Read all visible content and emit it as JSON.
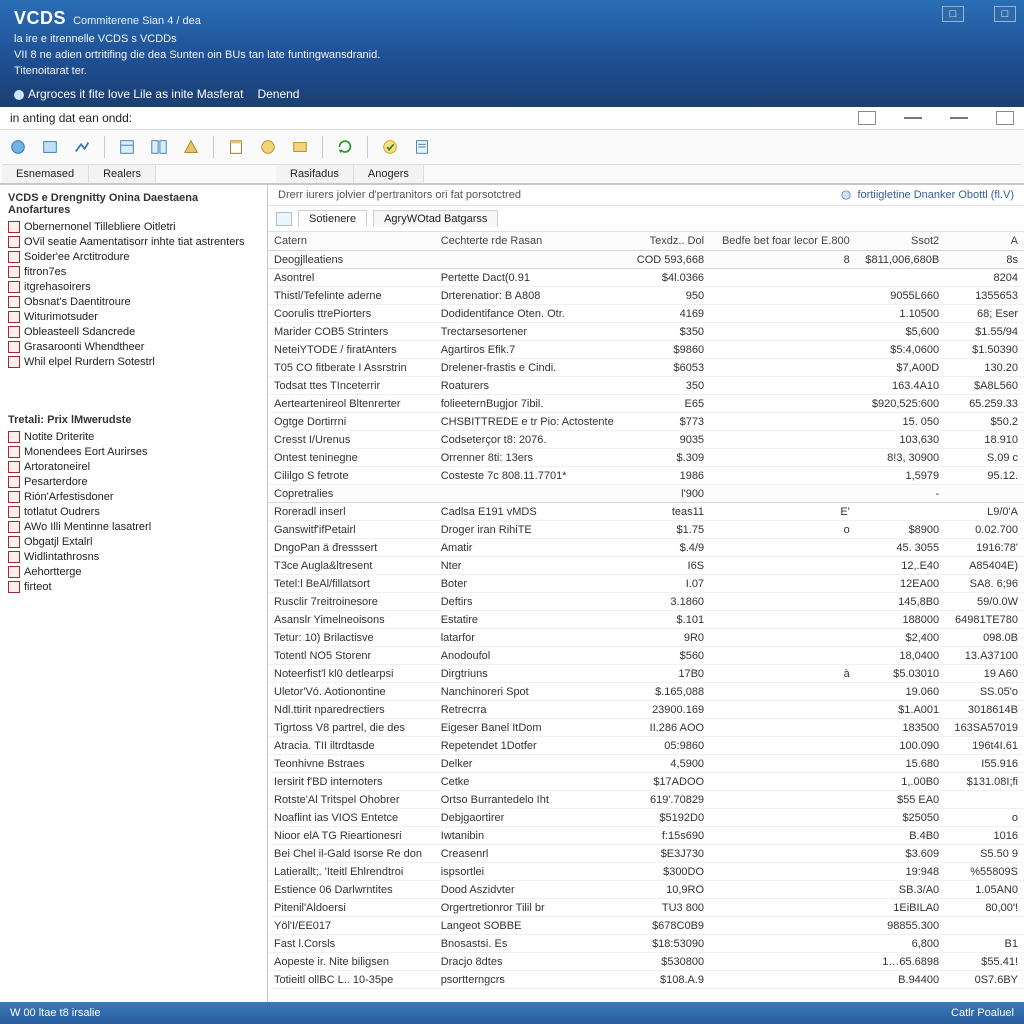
{
  "banner": {
    "title": "VCDS",
    "title_sub": "Commiterene Sian 4 / dea",
    "line_sub": "la ire e itrennelle VCDS s VCDDs",
    "line2": "VII 8 ne adien ortritifing die dea Sunten oin BUs tan late funtingwansdranid.",
    "line3": "Titenoitarat ter.",
    "link1": "Argroces it fite love Lile as inite Masferat",
    "link2": "Denend"
  },
  "windowbtns": {
    "a": "□",
    "b": "□"
  },
  "subheader": {
    "left": "in anting dat ean ondd:",
    "icons": [
      "□",
      "—",
      "—",
      "□"
    ]
  },
  "toolbar": {
    "tabs": [
      "Esnemased",
      "Realers",
      "Rasifadus",
      "Anogers"
    ]
  },
  "sidebar": {
    "group1_title": "VCDS e Drengnitty Onina Daestaena Anofartures",
    "group1": [
      "Obernernonel Tillebliere Oitletri",
      "OVil seatie Aamentatisorr inhte tiat astrenters",
      "Soider'ee Arctitrodure",
      "fitron7es",
      "itgrehasoirers",
      "Obsnat's Daentitroure",
      "Witurimotsuder",
      "Obleasteell Sdancrede",
      "Grasaroonti Whendtheer",
      "Whil elpel Rurdern Sotestrl"
    ],
    "group2_title": "Tretali: Prix lMwerudste",
    "group2": [
      "Notite Driterite",
      "Monendees Eort Aurirses",
      "Artoratoneirel",
      "Pesarterdore",
      "Rión'Arfestisdoner",
      "totlatut Oudrers",
      "AWo Illi Mentinne lasatrerl",
      "Obgatjl Extalrl",
      "Widlintathrosns",
      "Aehortterge",
      "firteot"
    ]
  },
  "content": {
    "header_left": "Drerr iurers jolvier d'pertranitors ori fat porsotctred",
    "header_right": "fortiigletine Dnanker Obottl (fl.V)",
    "subtabs": [
      "Sotienere",
      "AgryWOtad Batgarss"
    ]
  },
  "grid": {
    "columns": [
      "Catern",
      "Cechterte rde Rasan",
      "Texdz.. Dol",
      "Bedfe bet foar lecor E.800",
      "Ssot2",
      "A"
    ],
    "section1_label": "Deogjlleatiens",
    "section1_vals": [
      "COD 593,668",
      "8",
      "$811,006,680B",
      "8s"
    ],
    "rows1": [
      {
        "c0": "Asontrel",
        "c1": "Pertette Dact(0.91",
        "v0": "$4l.0366",
        "v1": "",
        "v2": "",
        "v3": "8204"
      },
      {
        "c0": "Thistl/Tefelinte aderne",
        "c1": "Drterenatior: B A808",
        "v0": "950",
        "v1": "",
        "v2": "9055L660",
        "v3": "1355653"
      },
      {
        "c0": "Coorulis ttrePiorters",
        "c1": "Dodidentifance Oten. Otr.",
        "v0": "4169",
        "v1": "",
        "v2": "1.10500",
        "v3": "68; Eser"
      },
      {
        "c0": "Marider COB5 Strinters",
        "c1": "Trectarsesortener",
        "v0": "$350",
        "v1": "",
        "v2": "$5,600",
        "v3": "$1.55/94"
      },
      {
        "c0": "NeteiYTODE / firatAnters",
        "c1": "Agartiros  Efik.7",
        "v0": "$9860",
        "v1": "",
        "v2": "$5:4,0600",
        "v3": "$1.50390"
      },
      {
        "c0": "T05 CO fitberate I Assrstrin",
        "c1": "Drelener-frastis e Cindi.",
        "v0": "$6053",
        "v1": "",
        "v2": "$7,A00D",
        "v3": "130.20"
      },
      {
        "c0": "Todsat ttes TInceterrir",
        "c1": "Roaturers",
        "v0": "350",
        "v1": "",
        "v2": "163.4A10",
        "v3": "$A8L560"
      },
      {
        "c0": "Aerteartenireol Bltenrerter",
        "c1": "folieeternBugjor  7ibil.",
        "v0": "E65",
        "v1": "",
        "v2": "$920,525:600",
        "v3": "65.259.33"
      },
      {
        "c0": "Ogtge Dortirrni",
        "c1": "CHSBITTREDE e tr Pio: Actostente",
        "v0": "$773",
        "v1": "",
        "v2": "15. 050",
        "v3": "$50.2"
      },
      {
        "c0": "Cresst I/Urenus",
        "c1": "Codseterçor t8: 2076.",
        "v0": "9035",
        "v1": "",
        "v2": "103,630",
        "v3": "18.910"
      },
      {
        "c0": "Ontest teninegne",
        "c1": "Orrenner 8ti: 13ers",
        "v0": "$.309",
        "v1": "",
        "v2": "8!3, 30900",
        "v3": "S.09 c"
      },
      {
        "c0": "Cililgo S fetrote",
        "c1": "Costeste 7c 808.11.7701*",
        "v0": "1986",
        "v1": "",
        "v2": "1,5979",
        "v3": "95.12."
      }
    ],
    "section2_label": "Copretralies",
    "section2_vals": [
      "l'900",
      "",
      "-",
      ""
    ],
    "rows2": [
      {
        "c0": "Roreradl inserl",
        "c1": "Cadlsa E191 vMDS",
        "v0": "teas11",
        "v1": "E'",
        "v2": "",
        "v3": "L9/0'A"
      },
      {
        "c0": "Ganswitf'ifPetairl",
        "c1": "Droger iran RihiTE",
        "v0": "$1.75",
        "v1": "o",
        "v2": "$8900",
        "v3": "0.02.700"
      },
      {
        "c0": "DngoPan ä đresssert",
        "c1": "Amatir",
        "v0": "$.4/9",
        "v1": "",
        "v2": "45. 3055",
        "v3": "1916:78'"
      },
      {
        "c0": "T3ce Augla&ltresent",
        "c1": "Nter",
        "v0": "I6S",
        "v1": "",
        "v2": "12,.E40",
        "v3": "A85404E)"
      },
      {
        "c0": "Tetel:l BeAl/fillatsort",
        "c1": "Boter",
        "v0": "I.07",
        "v1": "",
        "v2": "12EA00",
        "v3": "SA8. 6;96"
      },
      {
        "c0": "Rusclir 7reitroinesore",
        "c1": "Deftirs",
        "v0": "3.1860",
        "v1": "",
        "v2": "145,8B0",
        "v3": "59/0.0W"
      },
      {
        "c0": "Asanslr Yimelneoisons",
        "c1": "Estatire",
        "v0": "$.101",
        "v1": "",
        "v2": "188000",
        "v3": "64981TE780"
      },
      {
        "c0": "Tetur: 10) Brilactisve",
        "c1": "latarfor",
        "v0": "9R0",
        "v1": "",
        "v2": "$2,400",
        "v3": "098.0B"
      },
      {
        "c0": "Totentl NO5 Storenr",
        "c1": "Anodoufol",
        "v0": "$560",
        "v1": "",
        "v2": "18,0400",
        "v3": "13.A37100"
      },
      {
        "c0": "Noteerfist'l kl0 detlearpsi",
        "c1": "Dirgtriuns",
        "v0": "17B0",
        "v1": "à",
        "v2": "$5.03010",
        "v3": "19 A60"
      },
      {
        "c0": "Uletor'Vó.  Aotionontine",
        "c1": "Nanchinoreri Spot",
        "v0": "$.165,088",
        "v1": "",
        "v2": "19.060",
        "v3": "SS.05'o"
      },
      {
        "c0": "Ndl.ttirit nparedrectiers",
        "c1": "Retrecrra",
        "v0": "23900.169",
        "v1": "",
        "v2": "$1.A001",
        "v3": "3018614B"
      },
      {
        "c0": "Tigrtoss V8 partrel, die des",
        "c1": "Eigeser Banel ItDom",
        "v0": "II.286 AOO",
        "v1": "",
        "v2": "183500",
        "v3": "163SA57019"
      },
      {
        "c0": "Atracia. TII iltrdtasde",
        "c1": "Repetendet 1Dotfer",
        "v0": "05:9860",
        "v1": "",
        "v2": "100.090",
        "v3": "196t4I.61"
      },
      {
        "c0": "Teonhivne Bstraes",
        "c1": "Delker",
        "v0": "4,5900",
        "v1": "",
        "v2": "15.680",
        "v3": "I55.916"
      },
      {
        "c0": "Iersirit f'BD internoters",
        "c1": "Cetke",
        "v0": "$17ADOO",
        "v1": "",
        "v2": "1,.00B0",
        "v3": "$131.08I;fi"
      },
      {
        "c0": "Rotste'Al Tritspel Ohobrer",
        "c1": "Ortso Burrantedelo Iht",
        "v0": "619'.70829",
        "v1": "",
        "v2": "$55 EA0",
        "v3": ""
      },
      {
        "c0": "Noaflint ias VIOS Entetce",
        "c1": "Debjgaortirer",
        "v0": "$5192D0",
        "v1": "",
        "v2": "$25050",
        "v3": "o"
      },
      {
        "c0": "Nioor elA TG Rieartionesri",
        "c1": "Iwtanibin",
        "v0": "f:15s690",
        "v1": "",
        "v2": "B.4B0",
        "v3": "1016"
      },
      {
        "c0": "Bei Chel il-Gald Isorse Re don",
        "c1": "Creasenrl",
        "v0": "$E3J730",
        "v1": "",
        "v2": "$3.609",
        "v3": "S5.50  9"
      },
      {
        "c0": "Latierallt;. 'Iteitl Ehlrendtroi",
        "c1": "ispsortlei",
        "v0": "$300DO",
        "v1": "",
        "v2": "19:948",
        "v3": "%55809S"
      },
      {
        "c0": "Estience 06 Darlwrntites",
        "c1": "Dood Aszidvter",
        "v0": "10,9RO",
        "v1": "",
        "v2": "SB.3/A0",
        "v3": "1.05AN0"
      },
      {
        "c0": "Pitenil'Aldoersi",
        "c1": "Orgertretionror Tilil br",
        "v0": "TU3 800",
        "v1": "",
        "v2": "1EiBILA0",
        "v3": "80,00'!"
      },
      {
        "c0": "Yöl'I/EE017",
        "c1": "Langeot SOBBE",
        "v0": "$678C0B9",
        "v1": "",
        "v2": "98855.300",
        "v3": ""
      },
      {
        "c0": "Fast l.Corsls",
        "c1": "Bnosastsi. Es",
        "v0": "$18:53090",
        "v1": "",
        "v2": "6,800",
        "v3": "B1"
      },
      {
        "c0": "Aopeste ir. Nite biligsen",
        "c1": "Dracjo 8dtes",
        "v0": "$530800",
        "v1": "",
        "v2": "1…65.6898",
        "v3": "$55.41!"
      },
      {
        "c0": "Totieitl ollBC L.. 10-35pe",
        "c1": "psortterngcrs",
        "v0": "$108.A.9",
        "v1": "",
        "v2": "B.94400",
        "v3": "0S7.6BY"
      }
    ]
  },
  "status": {
    "left": "W 00 ltae t8 irsalie",
    "right": "Catlr Poaluel"
  }
}
